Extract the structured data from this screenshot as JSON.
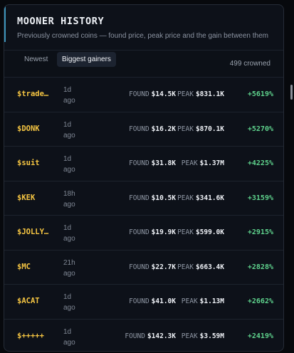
{
  "header": {
    "title": "MOONER HISTORY",
    "subtitle": "Previously crowned coins — found price, peak price and the gain between them"
  },
  "tabs": [
    {
      "label": "Newest"
    },
    {
      "label": "Biggest gainers"
    }
  ],
  "count_label": "499 crowned",
  "labels": {
    "found": "FOUND",
    "peak": "PEAK"
  },
  "rows": [
    {
      "symbol": "$trade…",
      "age_value": "1d",
      "age_suffix": "ago",
      "found": "$14.5K",
      "peak": "$831.1K",
      "gain": "+5619%"
    },
    {
      "symbol": "$DONK",
      "age_value": "1d",
      "age_suffix": "ago",
      "found": "$16.2K",
      "peak": "$870.1K",
      "gain": "+5270%"
    },
    {
      "symbol": "$suit",
      "age_value": "1d",
      "age_suffix": "ago",
      "found": "$31.8K",
      "peak": "$1.37M",
      "gain": "+4225%"
    },
    {
      "symbol": "$KEK",
      "age_value": "18h",
      "age_suffix": "ago",
      "found": "$10.5K",
      "peak": "$341.6K",
      "gain": "+3159%"
    },
    {
      "symbol": "$JOLLY…",
      "age_value": "1d",
      "age_suffix": "ago",
      "found": "$19.9K",
      "peak": "$599.0K",
      "gain": "+2915%"
    },
    {
      "symbol": "$MC",
      "age_value": "21h",
      "age_suffix": "ago",
      "found": "$22.7K",
      "peak": "$663.4K",
      "gain": "+2828%"
    },
    {
      "symbol": "$ACAT",
      "age_value": "1d",
      "age_suffix": "ago",
      "found": "$41.0K",
      "peak": "$1.13M",
      "gain": "+2662%"
    },
    {
      "symbol": "$+++++",
      "age_value": "1d",
      "age_suffix": "ago",
      "found": "$142.3K",
      "peak": "$3.59M",
      "gain": "+2419%"
    }
  ],
  "colors": {
    "accent": "#3c93b8",
    "symbol": "#f5c542",
    "gain": "#5fd38d",
    "background": "#0d1119"
  }
}
